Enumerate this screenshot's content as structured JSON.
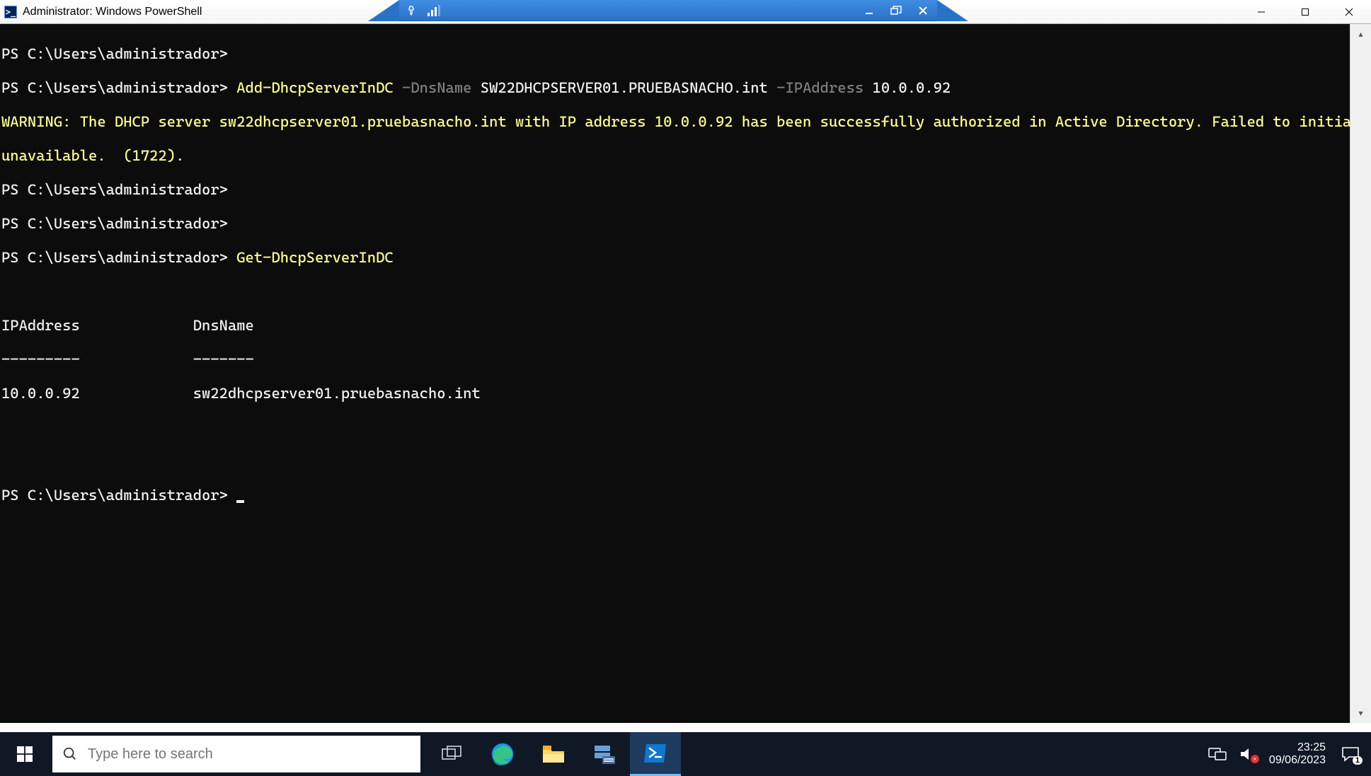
{
  "window": {
    "title": "Administrator: Windows PowerShell"
  },
  "hvbar": {
    "host": ""
  },
  "terminal": {
    "prompt": "PS C:\\Users\\administrador>",
    "cmd1": {
      "cmdlet": "Add-DhcpServerInDC",
      "param_dns": "-DnsName",
      "val_dns": "SW22DHCPSERVER01.PRUEBASNACHO.int",
      "param_ip": "-IPAddress",
      "val_ip": "10.0.0.92"
    },
    "warning_l1": "WARNING: The DHCP server sw22dhcpserver01.pruebasnacho.int with IP address 10.0.0.92 has been successfully authorized in Active Directory. Failed to initiate the authorizat",
    "warning_l2": "unavailable.  (1722).",
    "cmd2": "Get-DhcpServerInDC",
    "table": {
      "head_ip": "IPAddress",
      "head_dns": "DnsName",
      "rule_ip": "---------",
      "rule_dns": "-------",
      "row_ip": "10.0.0.92",
      "row_dns": "sw22dhcpserver01.pruebasnacho.int"
    }
  },
  "taskbar": {
    "search_placeholder": "Type here to search",
    "clock_time": "23:25",
    "clock_date": "09/06/2023",
    "notif_count": "1"
  }
}
